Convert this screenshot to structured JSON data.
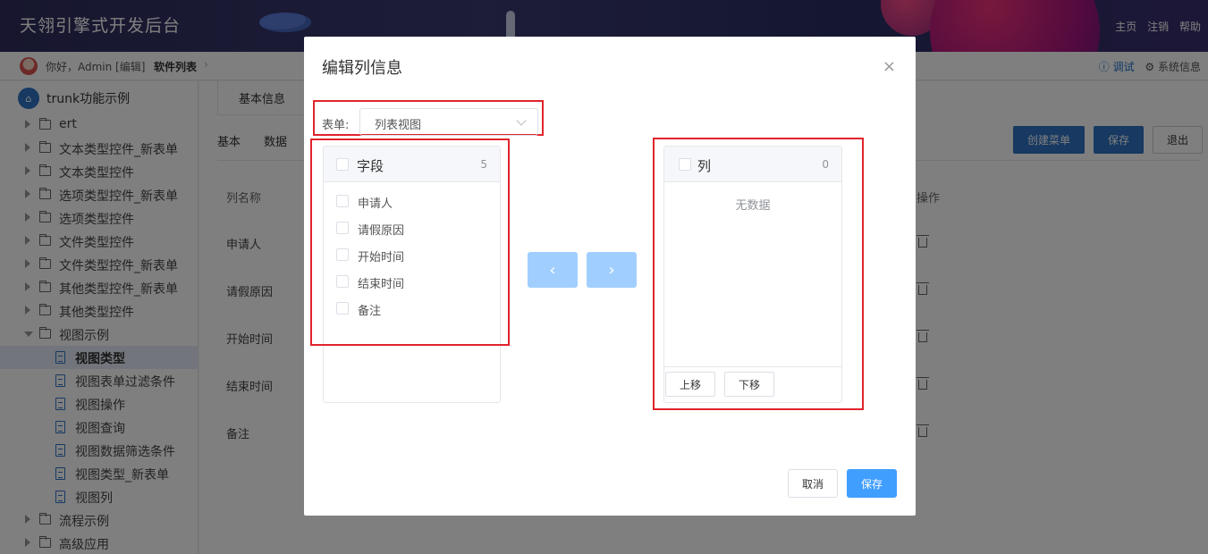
{
  "header": {
    "title": "天翎引擎式开发后台",
    "nav": [
      "主页",
      "注销",
      "帮助"
    ]
  },
  "subheader": {
    "greeting": "你好，Admin [编辑]",
    "breadcrumb": "软件列表",
    "debug": "调试",
    "system_info": "系统信息"
  },
  "sidebar": {
    "root": "trunk功能示例",
    "items": [
      {
        "label": "ert",
        "type": "folder"
      },
      {
        "label": "文本类型控件_新表单",
        "type": "folder"
      },
      {
        "label": "文本类型控件",
        "type": "folder"
      },
      {
        "label": "选项类型控件_新表单",
        "type": "folder"
      },
      {
        "label": "选项类型控件",
        "type": "folder"
      },
      {
        "label": "文件类型控件",
        "type": "folder"
      },
      {
        "label": "文件类型控件_新表单",
        "type": "folder"
      },
      {
        "label": "其他类型控件_新表单",
        "type": "folder"
      },
      {
        "label": "其他类型控件",
        "type": "folder"
      },
      {
        "label": "视图示例",
        "type": "folder-open"
      },
      {
        "label": "视图类型",
        "type": "leaf",
        "active": true
      },
      {
        "label": "视图表单过滤条件",
        "type": "leaf"
      },
      {
        "label": "视图操作",
        "type": "leaf"
      },
      {
        "label": "视图查询",
        "type": "leaf"
      },
      {
        "label": "视图数据筛选条件",
        "type": "leaf"
      },
      {
        "label": "视图类型_新表单",
        "type": "leaf"
      },
      {
        "label": "视图列",
        "type": "leaf"
      },
      {
        "label": "流程示例",
        "type": "folder"
      },
      {
        "label": "高级应用",
        "type": "folder"
      }
    ]
  },
  "main": {
    "tab_basic": "基本信息",
    "tabs": [
      "基本",
      "数据"
    ],
    "buttons": {
      "create_menu": "创建菜单",
      "save": "保存",
      "exit": "退出"
    },
    "table": {
      "col_name": "列名称",
      "col_ops": "操作",
      "rows": [
        "申请人",
        "请假原因",
        "开始时间",
        "结束时间",
        "备注"
      ]
    }
  },
  "modal": {
    "title": "编辑列信息",
    "close": "×",
    "form_label": "表单:",
    "form_value": "列表视图",
    "left_panel": {
      "title": "字段",
      "count": "5",
      "items": [
        "申请人",
        "请假原因",
        "开始时间",
        "结束时间",
        "备注"
      ]
    },
    "right_panel": {
      "title": "列",
      "count": "0",
      "empty": "无数据",
      "move_up": "上移",
      "move_down": "下移"
    },
    "arrow_left": "‹",
    "arrow_right": "›",
    "cancel": "取消",
    "save": "保存"
  },
  "colors": {
    "primary": "#409eff",
    "primary_dark": "#2f72c4",
    "highlight_box": "#e0242c",
    "disabled_arrow": "#a0cfff"
  }
}
